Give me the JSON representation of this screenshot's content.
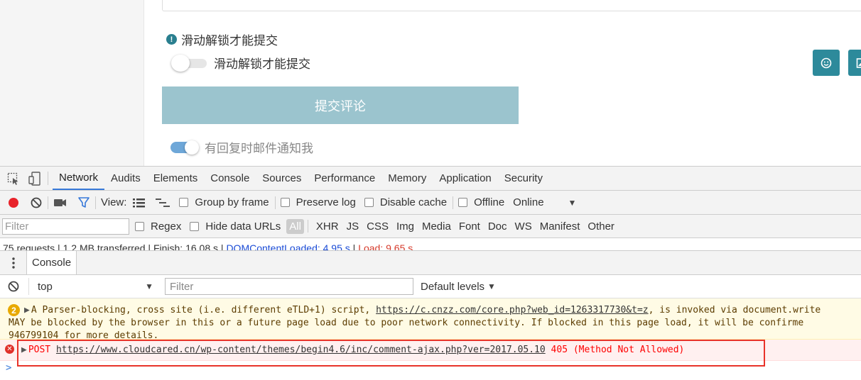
{
  "page": {
    "notice_icon": "!",
    "notice_text": "滑动解锁才能提交",
    "slider_label": "滑动解锁才能提交",
    "submit_label": "提交评论",
    "notify_label": "有回复时邮件通知我",
    "side_buttons": [
      "emoji-icon",
      "image-icon"
    ],
    "accent": "#2d8a9b"
  },
  "devtools": {
    "tabs": [
      "Network",
      "Audits",
      "Elements",
      "Console",
      "Sources",
      "Performance",
      "Memory",
      "Application",
      "Security"
    ],
    "active_tab": "Network",
    "toolbar": {
      "view_label": "View:",
      "group_by_frame": "Group by frame",
      "preserve_log": "Preserve log",
      "disable_cache": "Disable cache",
      "offline": "Offline",
      "throttle": "Online"
    },
    "filter": {
      "placeholder": "Filter",
      "regex": "Regex",
      "hide_data_urls": "Hide data URLs",
      "types": [
        "All",
        "XHR",
        "JS",
        "CSS",
        "Img",
        "Media",
        "Font",
        "Doc",
        "WS",
        "Manifest",
        "Other"
      ]
    },
    "status": {
      "requests": "75 requests",
      "transferred": "1.2 MB transferred",
      "finish": "Finish: 16.08 s",
      "dcl": "DOMContentLoaded: 4.95 s",
      "load": "Load: 9.65 s"
    },
    "drawer": {
      "tab": "Console",
      "context": "top",
      "filter_placeholder": "Filter",
      "levels": "Default levels"
    },
    "messages": {
      "warning": {
        "count": "2",
        "line1_prefix": "A Parser-blocking, cross site (i.e. different eTLD+1) script, ",
        "line1_link": "https://c.cnzz.com/core.php?web_id=1263317730&t=z",
        "line1_suffix": ", is invoked via document.write",
        "line2": "MAY be blocked by the browser in this or a future page load due to poor network connectivity. If blocked in this page load, it will be confirme",
        "line3": "946799104 for more details."
      },
      "error": {
        "method": "POST ",
        "url": "https://www.cloudcared.cn/wp-content/themes/begin4.6/inc/comment-ajax.php?ver=2017.05.10",
        "status": " 405 (Method Not Allowed)"
      }
    },
    "prompt": ">"
  }
}
